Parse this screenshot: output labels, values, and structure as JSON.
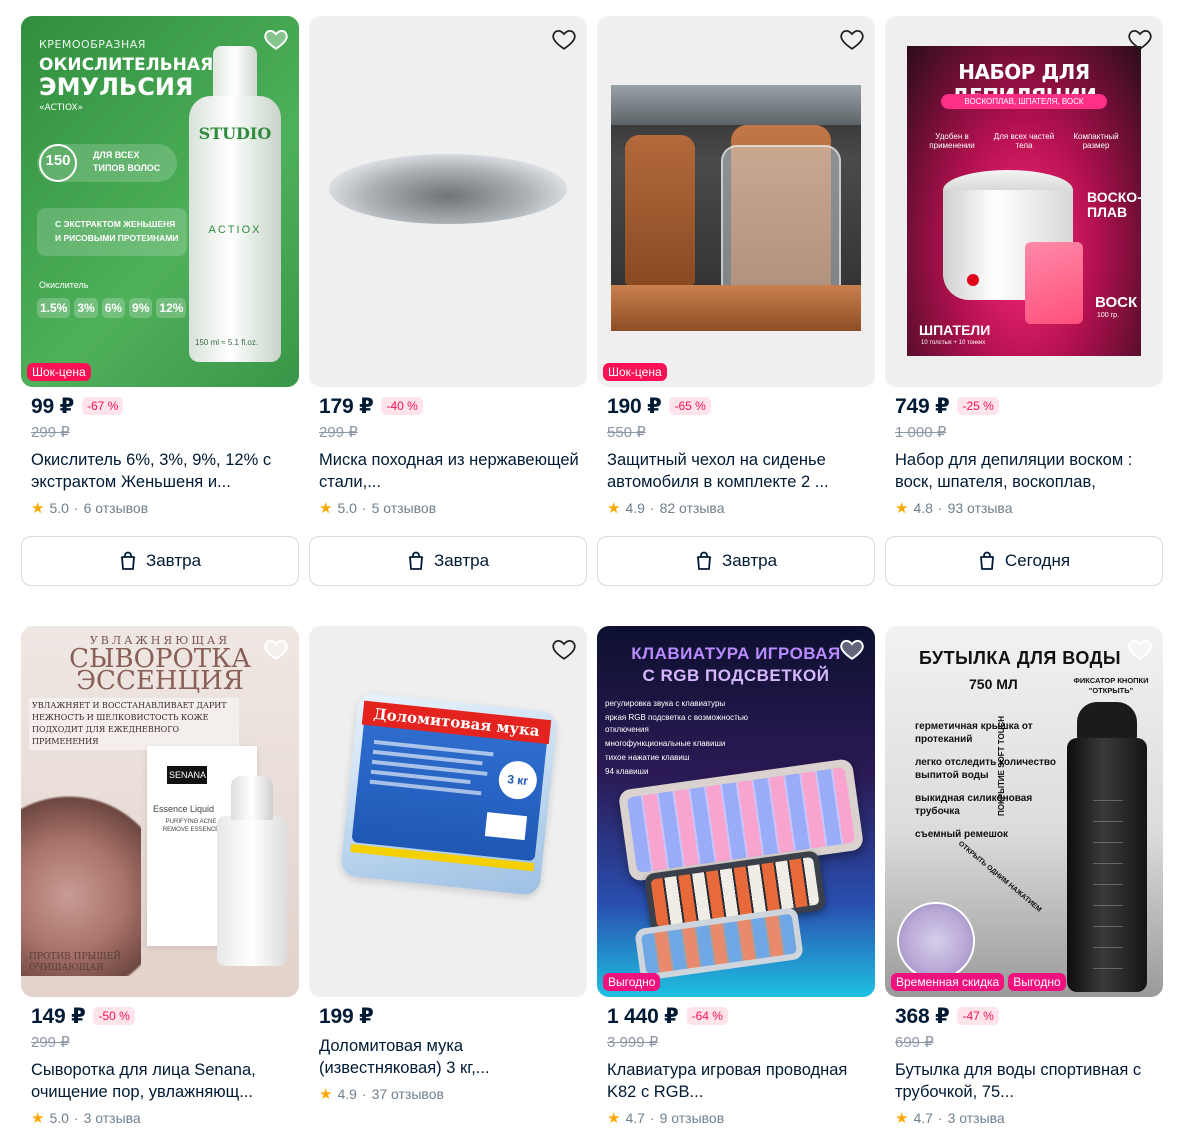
{
  "products": [
    {
      "price": "99 ₽",
      "discount": "-67 %",
      "old_price": "299 ₽",
      "title": "Окислитель 6%, 3%, 9%, 12% с экстрактом Женьшеня и...",
      "rating": "5.0",
      "reviews": "6 отзывов",
      "tags": [
        "Шок-цена"
      ],
      "delivery": "Завтра",
      "image_text": {
        "l1": "КРЕМООБРАЗНАЯ",
        "l2": "ОКИСЛИТЕЛЬНАЯ",
        "l3": "ЭМУЛЬСИЯ",
        "l4": "«ACTIOX»",
        "vol": "150",
        "ml": "мл",
        "hair": "ДЛЯ ВСЕХ ТИПОВ ВОЛОС",
        "extract": "С ЭКСТРАКТОМ ЖЕНЬШЕНЯ И РИСОВЫМИ ПРОТЕИНАМИ",
        "ox": "Окислитель",
        "pcts": [
          "1.5%",
          "3%",
          "6%",
          "9%",
          "12%"
        ],
        "brand": "STUDIO",
        "actiox": "ACTIOX",
        "bottle_ml": "150 ml ≈ 5.1 fl.oz."
      }
    },
    {
      "price": "179 ₽",
      "discount": "-40 %",
      "old_price": "299 ₽",
      "title": "Миска походная из нержавеющей стали,...",
      "rating": "5.0",
      "reviews": "5 отзывов",
      "tags": [],
      "delivery": "Завтра"
    },
    {
      "price": "190 ₽",
      "discount": "-65 %",
      "old_price": "550 ₽",
      "title": "Защитный чехол на сиденье автомобиля в комплекте 2 ...",
      "rating": "4.9",
      "reviews": "82 отзыва",
      "tags": [
        "Шок-цена"
      ],
      "delivery": "Завтра"
    },
    {
      "price": "749 ₽",
      "discount": "-25 %",
      "old_price": "1 000 ₽",
      "title": "Набор для депиляции воском : воск, шпателя, воскоплав,",
      "rating": "4.8",
      "reviews": "93 отзыва",
      "tags": [],
      "delivery": "Сегодня",
      "image_text": {
        "head": "НАБОР ДЛЯ ДЕПИЛЯЦИИ",
        "sub": "ВОСКОПЛАВ, ШПАТЕЛЯ, ВОСК",
        "f1": "Удобен в применении",
        "f2": "Для всех частей тела",
        "f3": "Компактный размер",
        "melt": "ВОСКО- ПЛАВ",
        "wax": "ВОСК",
        "wax_g": "100 гр.",
        "spat": "ШПАТЕЛИ",
        "spat_n": "10 толстых + 10 тонких"
      }
    },
    {
      "price": "149 ₽",
      "discount": "-50 %",
      "old_price": "299 ₽",
      "title": "Сыворотка для лица Senana, очищение пор, увлажняющ...",
      "rating": "5.0",
      "reviews": "3 отзыва",
      "tags": [],
      "image_text": {
        "top": "УВЛАЖНЯЮЩАЯ",
        "l1": "СЫВОРОТКА",
        "l2": "ЭССЕНЦИЯ",
        "desc": "УВЛАЖНЯЕТ И ВОССТАНАВЛИВАЕТ ДАРИТ НЕЖНОСТЬ И ШЕЛКОВИСТОСТЬ КОЖЕ ПОДХОДИТ ДЛЯ ЕЖЕДНЕВНОГО ПРИМЕНЕНИЯ",
        "brand": "SENANA",
        "box": "Essence Liquid",
        "box2": "PURIFYING ACNE REMOVE ESSENCE",
        "bottom": "ПРОТИВ ПРЫЩЕЙ ОЧИЩАЮЩАЯ"
      }
    },
    {
      "price": "199 ₽",
      "discount": "",
      "old_price": "",
      "title": "Доломитовая мука (известняковая) 3 кг,...",
      "rating": "4.9",
      "reviews": "37 отзывов",
      "tags": [],
      "image_text": {
        "bag": "Доломитовая мука",
        "kg": "3 кг"
      }
    },
    {
      "price": "1 440 ₽",
      "discount": "-64 %",
      "old_price": "3 999 ₽",
      "title": "Клавиатура игровая проводная K82 с RGB...",
      "rating": "4.7",
      "reviews": "9 отзывов",
      "tags": [
        "Выгодно"
      ],
      "image_text": {
        "l1": "КЛАВИАТУРА ИГРОВАЯ",
        "l2": "С RGB ПОДСВЕТКОЙ",
        "b": [
          "регулировка звука с клавиатуры",
          "яркая RGB подсветка с возможностью отключения",
          "многофункциональные клавиши",
          "тихое нажатие клавиш",
          "94 клавиши"
        ]
      }
    },
    {
      "price": "368 ₽",
      "discount": "-47 %",
      "old_price": "699 ₽",
      "title": "Бутылка для воды спортивная с трубочкой, 75...",
      "rating": "4.7",
      "reviews": "3 отзыва",
      "tags": [
        "Временная скидка",
        "Выгодно"
      ],
      "image_text": {
        "head": "БУТЫЛКА ДЛЯ ВОДЫ",
        "vol": "750 МЛ",
        "fix": "ФИКСАТОР КНОПКИ \"ОТКРЫТЬ\"",
        "b": [
          "герметичная крышка от протеканий",
          "легко отследить количество выпитой воды",
          "выкидная силиконовая трубочка",
          "съемный ремешок"
        ],
        "soft": "ПОКРЫТИЕ SOFT TOUCH",
        "open": "ОТКРЫТЬ ОДНИМ НАЖАТИЕМ"
      }
    }
  ],
  "colors": {
    "accent": "#f91155",
    "tag_pink": "#f1117e",
    "star": "#ffa800",
    "text": "#001a34",
    "muted": "#707f8d"
  },
  "icons": {
    "favorite": "heart-icon",
    "delivery": "bag-icon",
    "star": "star-icon"
  }
}
